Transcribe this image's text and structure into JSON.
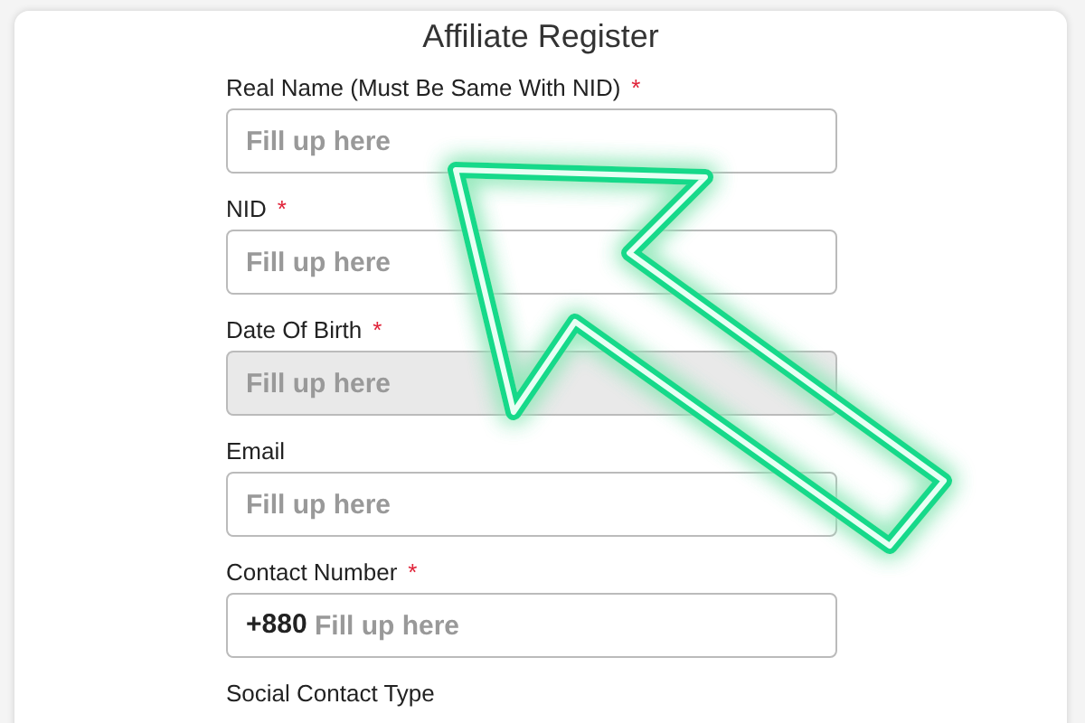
{
  "title": "Affiliate Register",
  "fields": [
    {
      "label": "Real Name (Must Be Same With NID)",
      "required": true,
      "placeholder": "Fill up here",
      "disabled": false
    },
    {
      "label": "NID",
      "required": true,
      "placeholder": "Fill up here",
      "disabled": false
    },
    {
      "label": "Date Of Birth",
      "required": true,
      "placeholder": "Fill up here",
      "disabled": true
    },
    {
      "label": "Email",
      "required": false,
      "placeholder": "Fill up here",
      "disabled": false
    },
    {
      "label": "Contact Number",
      "required": true,
      "placeholder": "Fill up here",
      "disabled": false,
      "prefix": "+880"
    }
  ],
  "next_label": "Social Contact Type",
  "required_mark": "*"
}
